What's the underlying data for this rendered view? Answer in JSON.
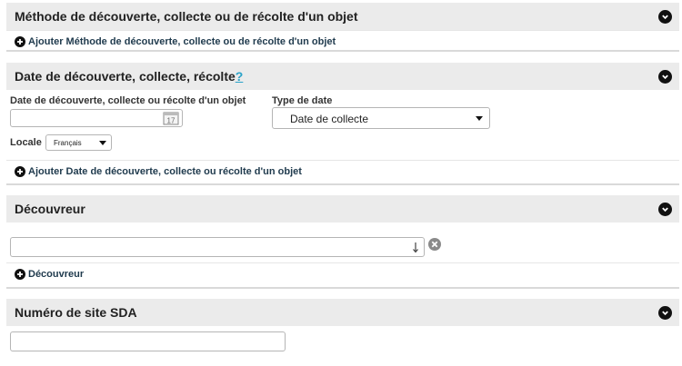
{
  "panels": {
    "method": {
      "title": "Méthode de découverte, collecte ou de récolte d'un objet",
      "add_label": "Ajouter Méthode de découverte, collecte ou de récolte d'un objet"
    },
    "date": {
      "title": "Date de découverte, collecte, récolte",
      "help_mark": "?",
      "date_label": "Date de découverte, collecte ou récolte d'un objet",
      "date_value": "",
      "type_label": "Type de date",
      "type_selected": "Date de collecte",
      "locale_label": "Locale",
      "locale_selected": "Français",
      "add_label": "Ajouter Date de découverte, collecte ou récolte d'un objet"
    },
    "discoverer": {
      "title": "Découvreur",
      "value": "",
      "add_label": "Découvreur"
    },
    "sda": {
      "title": "Numéro de site SDA",
      "value": ""
    }
  },
  "icons": {
    "toggle": "chevron-down-icon",
    "add": "plus-icon",
    "calendar": "calendar-icon",
    "lookup": "down-arrow-icon",
    "remove": "close-icon"
  }
}
